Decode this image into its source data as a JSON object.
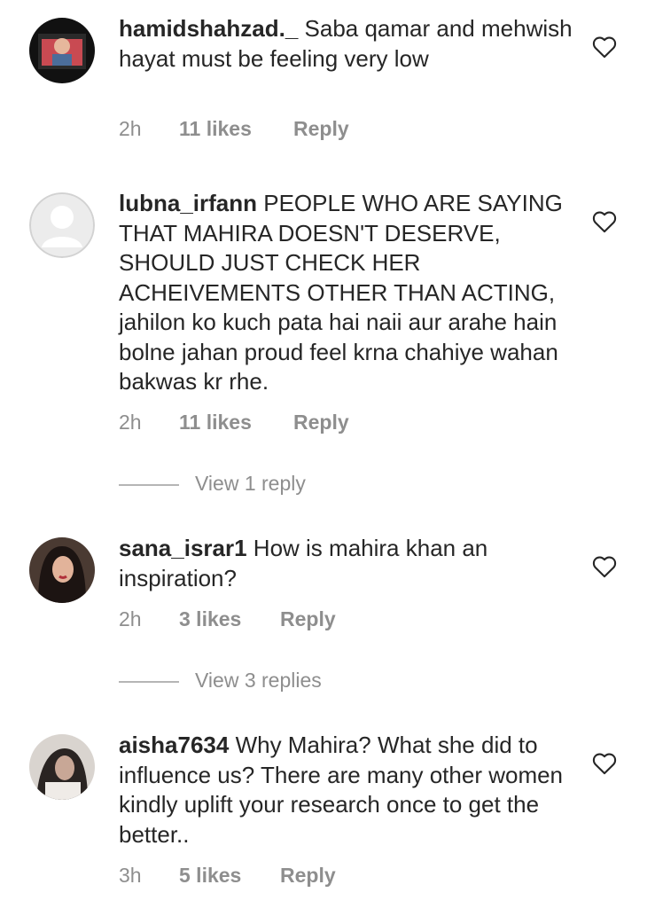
{
  "comments": [
    {
      "username": "hamidshahzad._",
      "text": "Saba qamar and mehwish hayat must be feeling very low",
      "time": "2h",
      "likes": "11 likes",
      "reply_label": "Reply",
      "avatar_icon": "profile-photo"
    },
    {
      "username": "lubna_irfann",
      "text": "PEOPLE  WHO ARE SAYING THAT MAHIRA DOESN'T DESERVE, SHOULD JUST CHECK HER ACHEIVEMENTS OTHER THAN ACTING, jahilon ko kuch pata hai naii aur arahe hain bolne jahan proud feel krna chahiye wahan bakwas kr rhe.",
      "time": "2h",
      "likes": "11 likes",
      "reply_label": "Reply",
      "avatar_icon": "default-avatar",
      "view_replies": "View 1 reply"
    },
    {
      "username": "sana_israr1",
      "text": "How is mahira khan an inspiration?",
      "time": "2h",
      "likes": "3 likes",
      "reply_label": "Reply",
      "avatar_icon": "profile-photo",
      "view_replies": "View 3 replies"
    },
    {
      "username": "aisha7634",
      "text": "Why Mahira? What she did to influence us? There are many other women kindly uplift your research once to get the better..",
      "time": "3h",
      "likes": "5 likes",
      "reply_label": "Reply",
      "avatar_icon": "profile-photo"
    }
  ],
  "icons": {
    "like": "heart-outline-icon"
  },
  "colors": {
    "text": "#262626",
    "secondary": "#8e8e8e",
    "divider": "#b5b5b5"
  }
}
